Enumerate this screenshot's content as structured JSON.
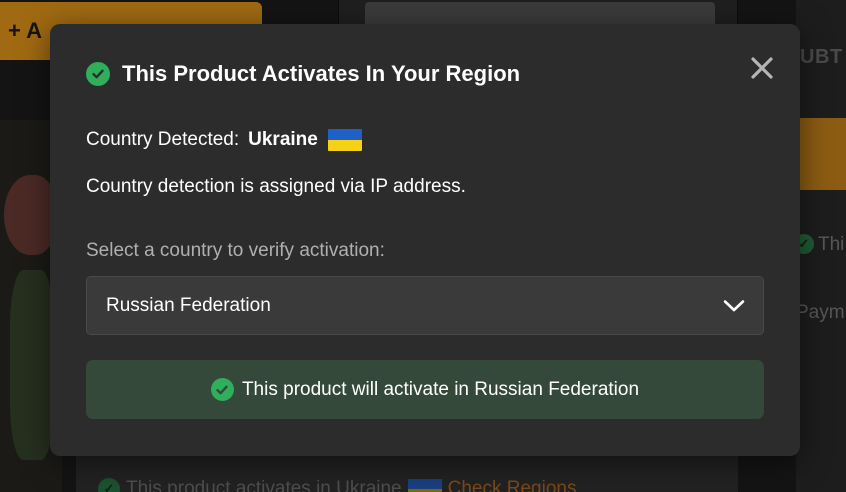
{
  "background": {
    "add_button_label": "+ A",
    "panel_title_fragment": "UBT",
    "side_text_fragment": "Thi",
    "payment_fragment": "Paym",
    "bottom_line": {
      "text": "This product activates in Ukraine",
      "link": "Check Regions"
    }
  },
  "modal": {
    "title": "This Product Activates In Your Region",
    "close_icon": "close-icon",
    "detected_label": "Country Detected:",
    "detected_country": "Ukraine",
    "flag_colors": [
      "#1f5fc8",
      "#f7d117"
    ],
    "detection_note": "Country detection is assigned via IP address.",
    "select_label": "Select a country to verify activation:",
    "selected_country": "Russian Federation",
    "result_text": "This product will activate in Russian Federation"
  },
  "colors": {
    "modal_bg": "#2c2c2c",
    "success_green": "#2fae5c",
    "result_bg": "#34493a",
    "accent_orange": "#a06a12"
  }
}
